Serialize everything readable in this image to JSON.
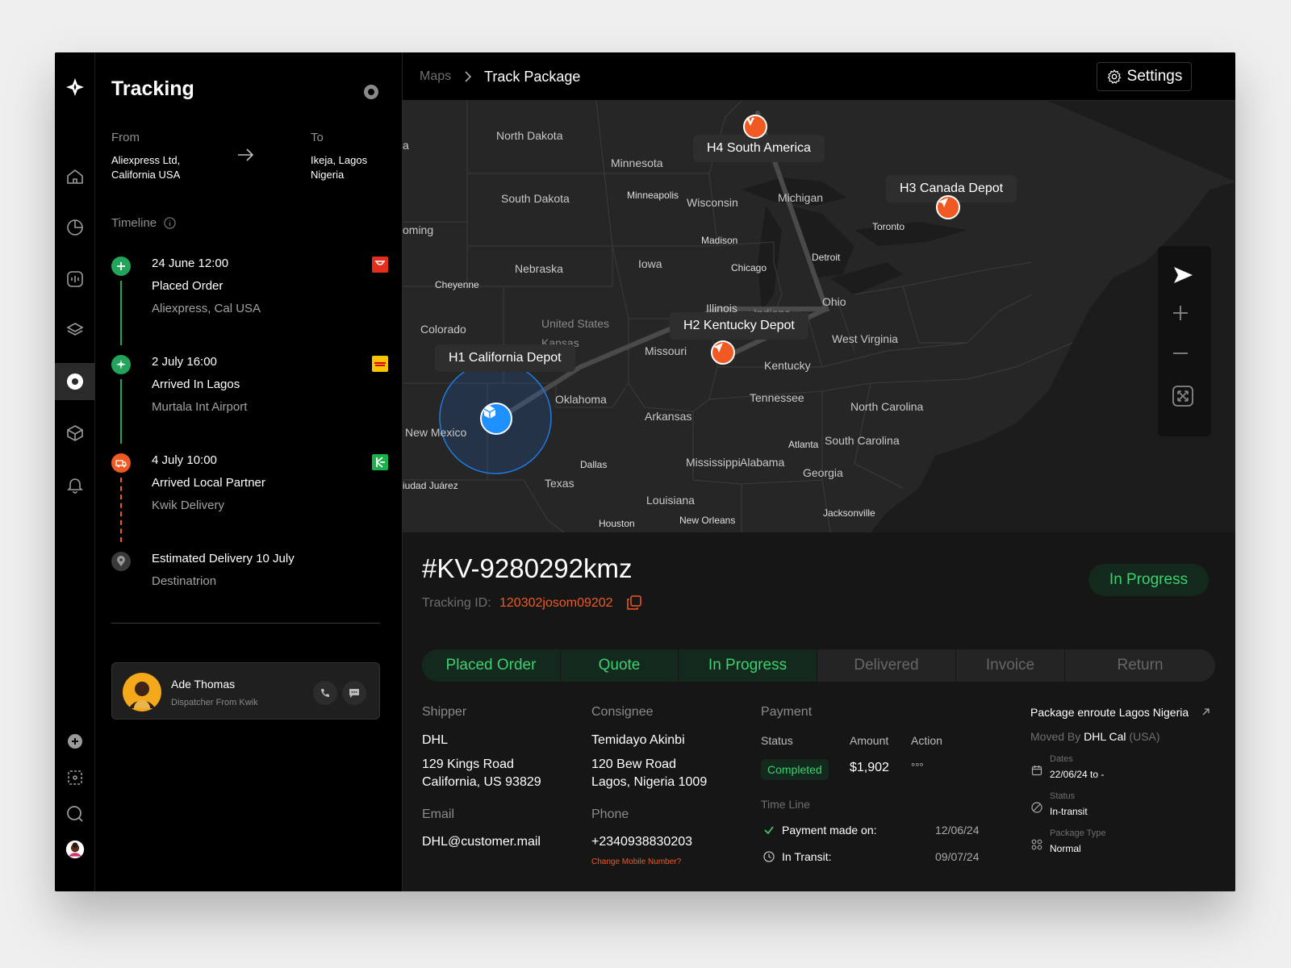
{
  "panel": {
    "title": "Tracking",
    "from_label": "From",
    "from_line1": "Aliexpress Ltd,",
    "from_line2": "California USA",
    "to_label": "To",
    "to_line1": "Ikeja, Lagos",
    "to_line2": "Nigeria",
    "timeline_label": "Timeline",
    "timeline": [
      {
        "date": "24 June 12:00",
        "title": "Placed Order",
        "sub": "Aliexpress, Cal USA"
      },
      {
        "date": "2 July 16:00",
        "title": "Arrived In Lagos",
        "sub": "Murtala Int Airport"
      },
      {
        "date": "4 July 10:00",
        "title": "Arrived Local Partner",
        "sub": "Kwik Delivery"
      },
      {
        "title": "Estimated Delivery 10 July",
        "sub": "Destinatrion"
      }
    ],
    "contact": {
      "name": "Ade Thomas",
      "role": "Dispatcher From Kwik"
    }
  },
  "topbar": {
    "crumb_root": "Maps",
    "crumb_current": "Track Package",
    "settings": "Settings"
  },
  "map": {
    "labels": [
      "North Dakota",
      "Minnesota",
      "South Dakota",
      "Minneapolis",
      "Wisconsin",
      "Michigan",
      "oming",
      "Madison",
      "Toronto",
      "Nebraska",
      "Iowa",
      "Chicago",
      "Detroit",
      "Cheyenne",
      "Illinois",
      "Indiana",
      "Ohio",
      "Colorado",
      "United States",
      "Kansas",
      "Missouri",
      "West Virginia",
      "Kentucky",
      "Oklahoma",
      "Tennessee",
      "North Carolina",
      "Arkansas",
      "New Mexico",
      "Atlanta",
      "South Carolina",
      "Dallas",
      "Mississippi",
      "Alabama",
      "Georgia",
      "iudad Juárez",
      "Texas",
      "Louisiana",
      "Jacksonville",
      "New Orleans",
      "Houston",
      "a"
    ],
    "depots": {
      "h1": "H1 California Depot",
      "h2": "H2 Kentucky Depot",
      "h3": "H3 Canada Depot",
      "h4": "H4 South America"
    }
  },
  "package": {
    "id": "#KV-9280292kmz",
    "tracking_label": "Tracking ID:",
    "tracking_id": "120302josom09202",
    "status_badge": "In Progress",
    "steps": [
      {
        "label": "Placed Order",
        "active": true
      },
      {
        "label": "Quote",
        "active": true
      },
      {
        "label": "In Progress",
        "active": true
      },
      {
        "label": "Delivered",
        "active": false
      },
      {
        "label": "Invoice",
        "active": false
      },
      {
        "label": "Return",
        "active": false
      }
    ],
    "shipper": {
      "label": "Shipper",
      "name": "DHL",
      "address1": "129 Kings Road",
      "address2": "California, US 93829",
      "email_label": "Email",
      "email": "DHL@customer.mail"
    },
    "consignee": {
      "label": "Consignee",
      "name": "Temidayo Akinbi",
      "address1": "120 Bew Road",
      "address2": "Lagos, Nigeria 1009",
      "phone_label": "Phone",
      "phone": "+2340938830203",
      "change_link": "Change Mobile Number?"
    },
    "payment": {
      "label": "Payment",
      "status_label": "Status",
      "amount_label": "Amount",
      "action_label": "Action",
      "status": "Completed",
      "amount": "$1,902",
      "action": "°°°",
      "timeline_label": "Time Line",
      "paid_label": "Payment made on:",
      "paid_date": "12/06/24",
      "transit_label": "In Transit:",
      "transit_date": "09/07/24"
    },
    "enroute": {
      "title": "Package enroute Lagos Nigeria",
      "moved_prefix": "Moved By",
      "moved_by": "DHL Cal",
      "moved_suffix": "(USA)",
      "dates_label": "Dates",
      "dates": "22/06/24 to -",
      "status_label": "Status",
      "status": "In-transit",
      "type_label": "Package Type",
      "type": "Normal"
    }
  },
  "colors": {
    "accent_green": "#3bd16f",
    "accent_orange": "#f05a22",
    "accent_blue": "#1e90ff"
  }
}
